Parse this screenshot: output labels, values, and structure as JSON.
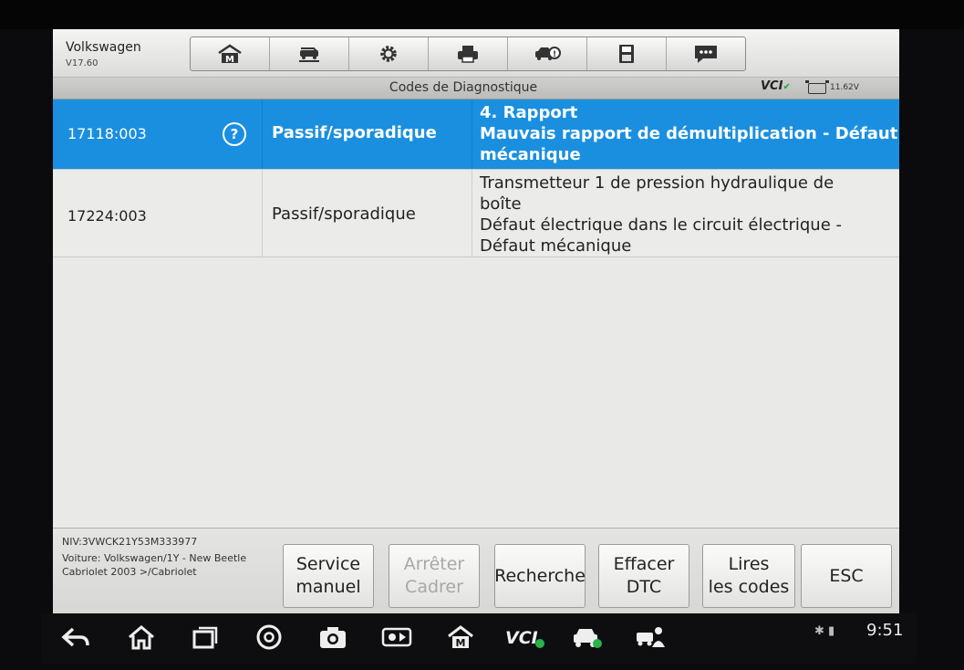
{
  "app": {
    "title": "Volkswagen",
    "version": "V17.60"
  },
  "toolbar": {
    "icons": [
      "home-icon",
      "vehicle-swap-icon",
      "settings-icon",
      "print-icon",
      "vehicle-diagnose-icon",
      "save-icon",
      "message-icon"
    ]
  },
  "subbar": {
    "title": "Codes de Diagnostique",
    "vci": "VCI",
    "voltage": "11.62V"
  },
  "dtcs": [
    {
      "code": "17118:003",
      "status": "Passif/sporadique",
      "description": [
        "4. Rapport",
        "Mauvais rapport de démultiplication - Défaut",
        "mécanique"
      ],
      "selected": true
    },
    {
      "code": "17224:003",
      "status": "Passif/sporadique",
      "description": [
        "Transmetteur 1 de pression hydraulique de",
        "boîte",
        "Défaut électrique dans le circuit électrique -",
        "Défaut mécanique"
      ],
      "selected": false
    }
  ],
  "footer": {
    "vin": "NIV:3VWCK21Y53M333977",
    "vehicle": "Voiture: Volkswagen/1Y - New Beetle Cabriolet 2003 >/Cabriolet",
    "buttons": {
      "service_manual": "Service\nmanuel",
      "stop_frame": "Arrêter\nCadrer",
      "search": "Recherche",
      "clear_dtc": "Effacer\nDTC",
      "read_codes": "Lires\nles codes",
      "esc": "ESC"
    }
  },
  "system": {
    "time": "9:51"
  },
  "colors": {
    "selected_row": "#1a8fe0",
    "screen_bg": "#e9e9e7"
  }
}
